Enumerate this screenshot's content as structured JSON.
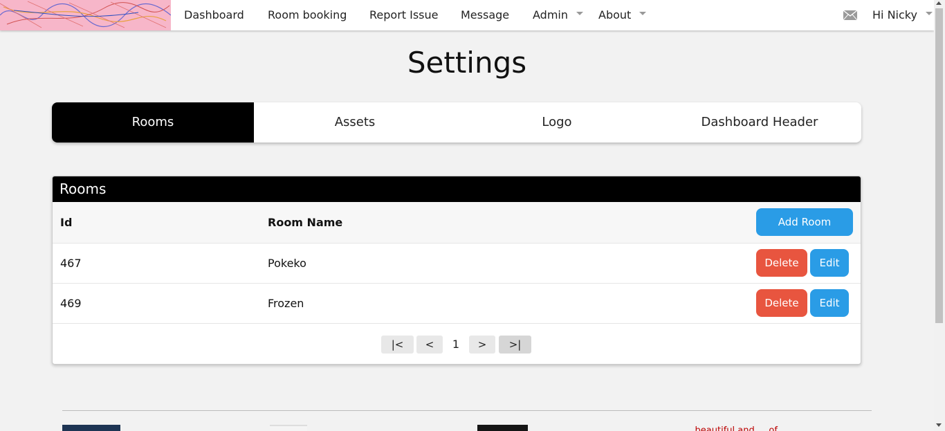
{
  "nav": {
    "items": [
      {
        "label": "Dashboard"
      },
      {
        "label": "Room booking"
      },
      {
        "label": "Report Issue"
      },
      {
        "label": "Message"
      },
      {
        "label": "Admin"
      },
      {
        "label": "About"
      }
    ],
    "greeting": "Hi Nicky"
  },
  "page": {
    "title": "Settings"
  },
  "tabs": [
    {
      "label": "Rooms",
      "active": true
    },
    {
      "label": "Assets"
    },
    {
      "label": "Logo"
    },
    {
      "label": "Dashboard Header"
    }
  ],
  "panel": {
    "title": "Rooms",
    "columns": {
      "id": "Id",
      "name": "Room Name"
    },
    "add_label": "Add Room",
    "rows": [
      {
        "id": "467",
        "name": "Pokeko",
        "delete": "Delete",
        "edit": "Edit"
      },
      {
        "id": "469",
        "name": "Frozen",
        "delete": "Delete",
        "edit": "Edit"
      }
    ]
  },
  "pager": {
    "first": "|<",
    "prev": "<",
    "current": "1",
    "next": ">",
    "last": ">|"
  },
  "footer": {
    "text": "... beautiful and ... of ..."
  },
  "colors": {
    "accent": "#2a9ce6",
    "danger": "#e8553f",
    "active_tab": "#000000"
  }
}
